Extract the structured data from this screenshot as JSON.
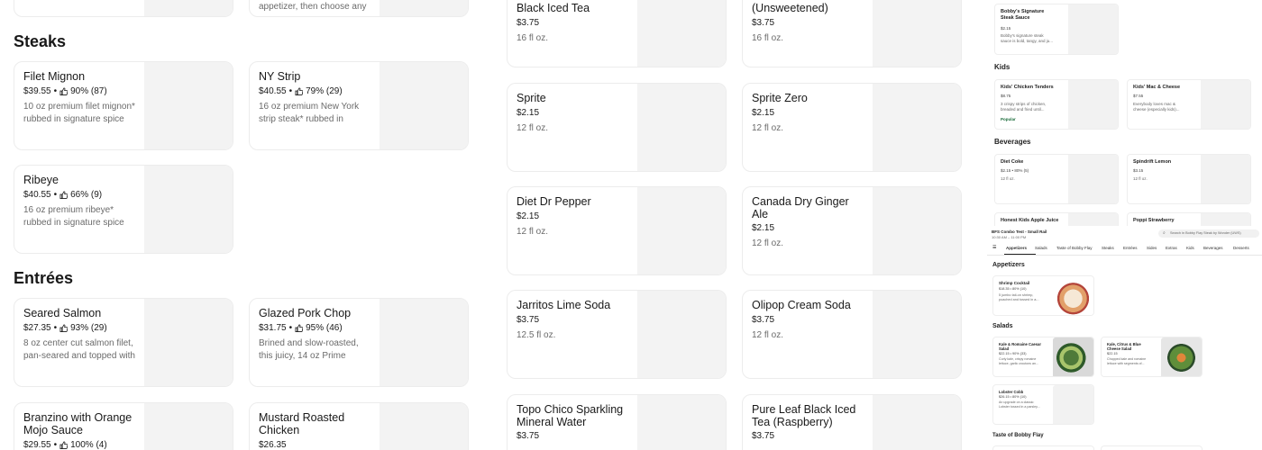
{
  "top_partial": {
    "card_a_desc": "appetizer, then choose any",
    "bev_left_title": "Black Iced Tea",
    "bev_left_price": "$3.75",
    "bev_left_size": "16 fl oz.",
    "bev_right_title": "(Unsweetened)",
    "bev_right_price": "$3.75",
    "bev_right_size": "16 fl oz."
  },
  "sections": {
    "steaks": "Steaks",
    "entrees": "Entrées"
  },
  "steaks": [
    {
      "title": "Filet Mignon",
      "price": "$39.55",
      "rating": "90% (87)",
      "desc1": "10 oz premium filet mignon*",
      "desc2": "rubbed in signature spice"
    },
    {
      "title": "NY Strip",
      "price": "$40.55",
      "rating": "79% (29)",
      "desc1": "16 oz premium New York",
      "desc2": "strip steak* rubbed in"
    },
    {
      "title": "Ribeye",
      "price": "$40.55",
      "rating": "66% (9)",
      "desc1": "16 oz premium ribeye*",
      "desc2": "rubbed in signature spice"
    }
  ],
  "entrees": [
    {
      "title": "Seared Salmon",
      "price": "$27.35",
      "rating": "93% (29)",
      "desc1": "8 oz center cut salmon filet,",
      "desc2": "pan-seared and topped with"
    },
    {
      "title": "Glazed Pork Chop",
      "price": "$31.75",
      "rating": "95% (46)",
      "desc1": "Brined and slow-roasted,",
      "desc2": "this juicy, 14 oz Prime"
    },
    {
      "title1": "Branzino with Orange",
      "title2": "Mojo Sauce",
      "price": "$29.55",
      "rating": "100% (4)"
    },
    {
      "title1": "Mustard Roasted",
      "title2": "Chicken",
      "price": "$26.35"
    }
  ],
  "beverages": [
    {
      "title": "Sprite",
      "price": "$2.15",
      "size": "12 fl oz."
    },
    {
      "title": "Sprite Zero",
      "price": "$2.15",
      "size": "12 fl oz."
    },
    {
      "title": "Diet Dr Pepper",
      "price": "$2.15",
      "size": "12 fl oz."
    },
    {
      "title": "Canada Dry Ginger Ale",
      "price": "$2.15",
      "size": "12 fl oz."
    },
    {
      "title": "Jarritos Lime Soda",
      "price": "$3.75",
      "size": "12.5 fl oz."
    },
    {
      "title": "Olipop Cream Soda",
      "price": "$3.75",
      "size": "12 fl oz."
    },
    {
      "title1": "Topo Chico Sparkling",
      "title2": "Mineral Water",
      "price": "$3.75"
    },
    {
      "title1": "Pure Leaf Black Iced",
      "title2": "Tea (Raspberry)",
      "price": "$3.75"
    }
  ],
  "preview": {
    "sauce_title1": "Bobby's Signature",
    "sauce_title2": "Steak Sauce",
    "sauce_price": "$2.15",
    "sauce_desc1": "Bobby's signature steak",
    "sauce_desc2": "sauce is bold, tangy, and ju...",
    "kids": "Kids",
    "kid1_title": "Kids' Chicken Tenders",
    "kid1_price": "$8.75",
    "kid1_desc1": "3 crispy strips of chicken,",
    "kid1_desc2": "breaded and fried until...",
    "kid1_badge": "Popular",
    "kid2_title": "Kids' Mac & Cheese",
    "kid2_price": "$7.55",
    "kid2_desc1": "Everybody loves mac &",
    "kid2_desc2": "cheese (especially kids)...",
    "beverages": "Beverages",
    "bev1_title": "Diet Coke",
    "bev1_meta": "$2.15 • 80% (5)",
    "bev1_size": "12 fl oz.",
    "bev2_title": "Spindrift Lemon",
    "bev2_price": "$3.15",
    "bev2_size": "12 fl oz.",
    "bev3_title": "Honest Kids Apple Juice",
    "bev4_title": "Poppi Strawberry",
    "store_line1": "BFS Combo Test - Small Rail",
    "store_line2": "10:30 AM – 11:00 PM",
    "search_placeholder": "Search in Bobby Flay Steak by Wonder (UWS)",
    "tabs": [
      "Appetizers",
      "Salads",
      "Taste of Bobby Flay",
      "Steaks",
      "Entrées",
      "Sides",
      "Extras",
      "Kids",
      "Beverages",
      "Desserts"
    ],
    "appetizers": "Appetizers",
    "app1_title": "Shrimp Cocktail",
    "app1_meta": "$18.35 • 80% (10)",
    "app1_desc1": "5 jumbo tail-on shrimp,",
    "app1_desc2": "poached and tossed in a...",
    "salads": "Salads",
    "sal1_title1": "Kale & Romaine Caesar",
    "sal1_title2": "Salad",
    "sal1_meta": "$22.15 • 90% (33)",
    "sal1_desc1": "Curly kale, crispy romaine",
    "sal1_desc2": "lettuce, garlic croutons an...",
    "sal2_title1": "Kale, Citrus & Blue",
    "sal2_title2": "Cheese Salad",
    "sal2_price": "$22.15",
    "sal2_desc1": "Chopped kale and romaine",
    "sal2_desc2": "lettuce with segments of...",
    "sal3_title": "Lobster Cobb",
    "sal3_meta": "$26.15 • 80% (10)",
    "sal3_desc1": "An upgrade on a classic:",
    "sal3_desc2": "Lobster tossed in a parsley...",
    "taste": "Taste of Bobby Flay"
  },
  "colors": {
    "card_image_placeholder": "#f3f3f3",
    "muted_text": "#6b6b6b",
    "border": "#ececec"
  }
}
